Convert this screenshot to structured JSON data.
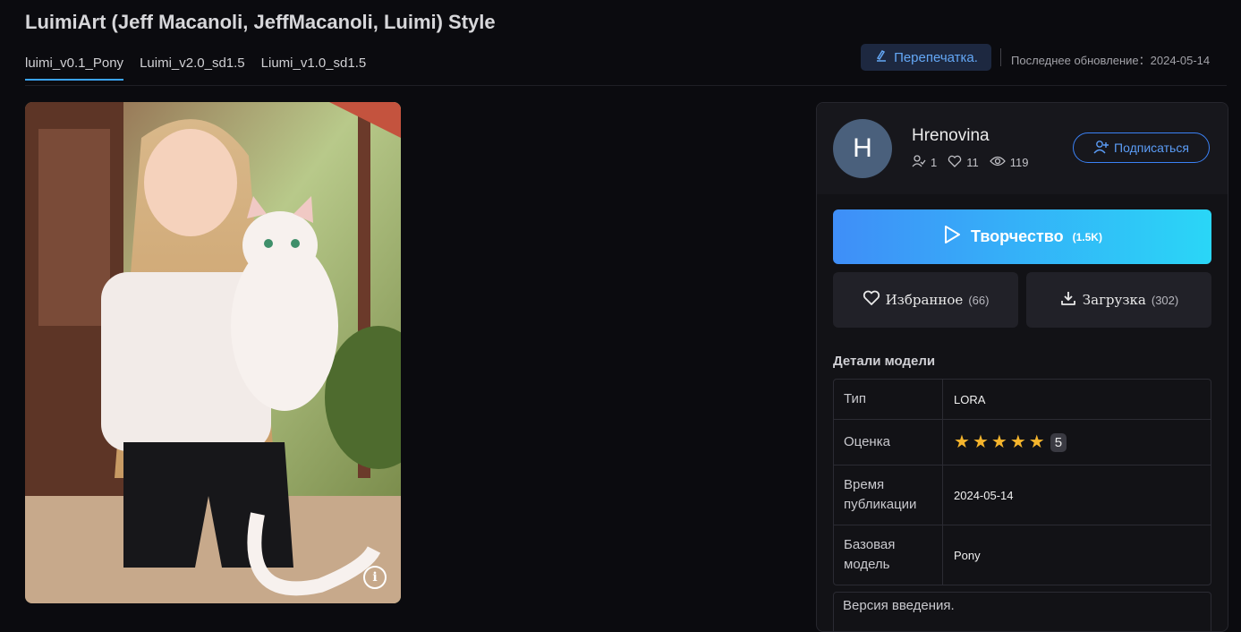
{
  "page": {
    "title": "LuimiArt (Jeff Macanoli, JeffMacanoli, Luimi) Style"
  },
  "versions": [
    "luimi_v0.1_Pony",
    "Luimi_v2.0_sd1.5",
    "Liumi_v1.0_sd1.5"
  ],
  "header": {
    "reprint_label": "Перепечатка.",
    "updated_label": "Последнее обновление：",
    "updated_date": "2024-05-14"
  },
  "author": {
    "initial": "H",
    "name": "Hrenovina",
    "followers": "1",
    "likes": "11",
    "views": "119",
    "subscribe_label": "Подписаться"
  },
  "actions": {
    "create_label": "Творчество",
    "create_count": "(1.5K)",
    "favorite_label": "Избранное",
    "favorite_count": "(66)",
    "download_label": "Загрузка",
    "download_count": "(302)"
  },
  "details": {
    "title": "Детали модели",
    "rows": [
      {
        "key": "Тип",
        "value": "LORA"
      },
      {
        "key": "Оценка",
        "value": "5",
        "stars": 5
      },
      {
        "key": "Время публикации",
        "value": "2024-05-14"
      },
      {
        "key": "Базовая модель",
        "value": "Pony"
      }
    ],
    "intro_label": "Версия введения."
  },
  "colors": {
    "accent": "#3ba4f7",
    "gradient_start": "#3f8ef8",
    "gradient_end": "#2ad6f7",
    "star": "#f5b52d"
  }
}
